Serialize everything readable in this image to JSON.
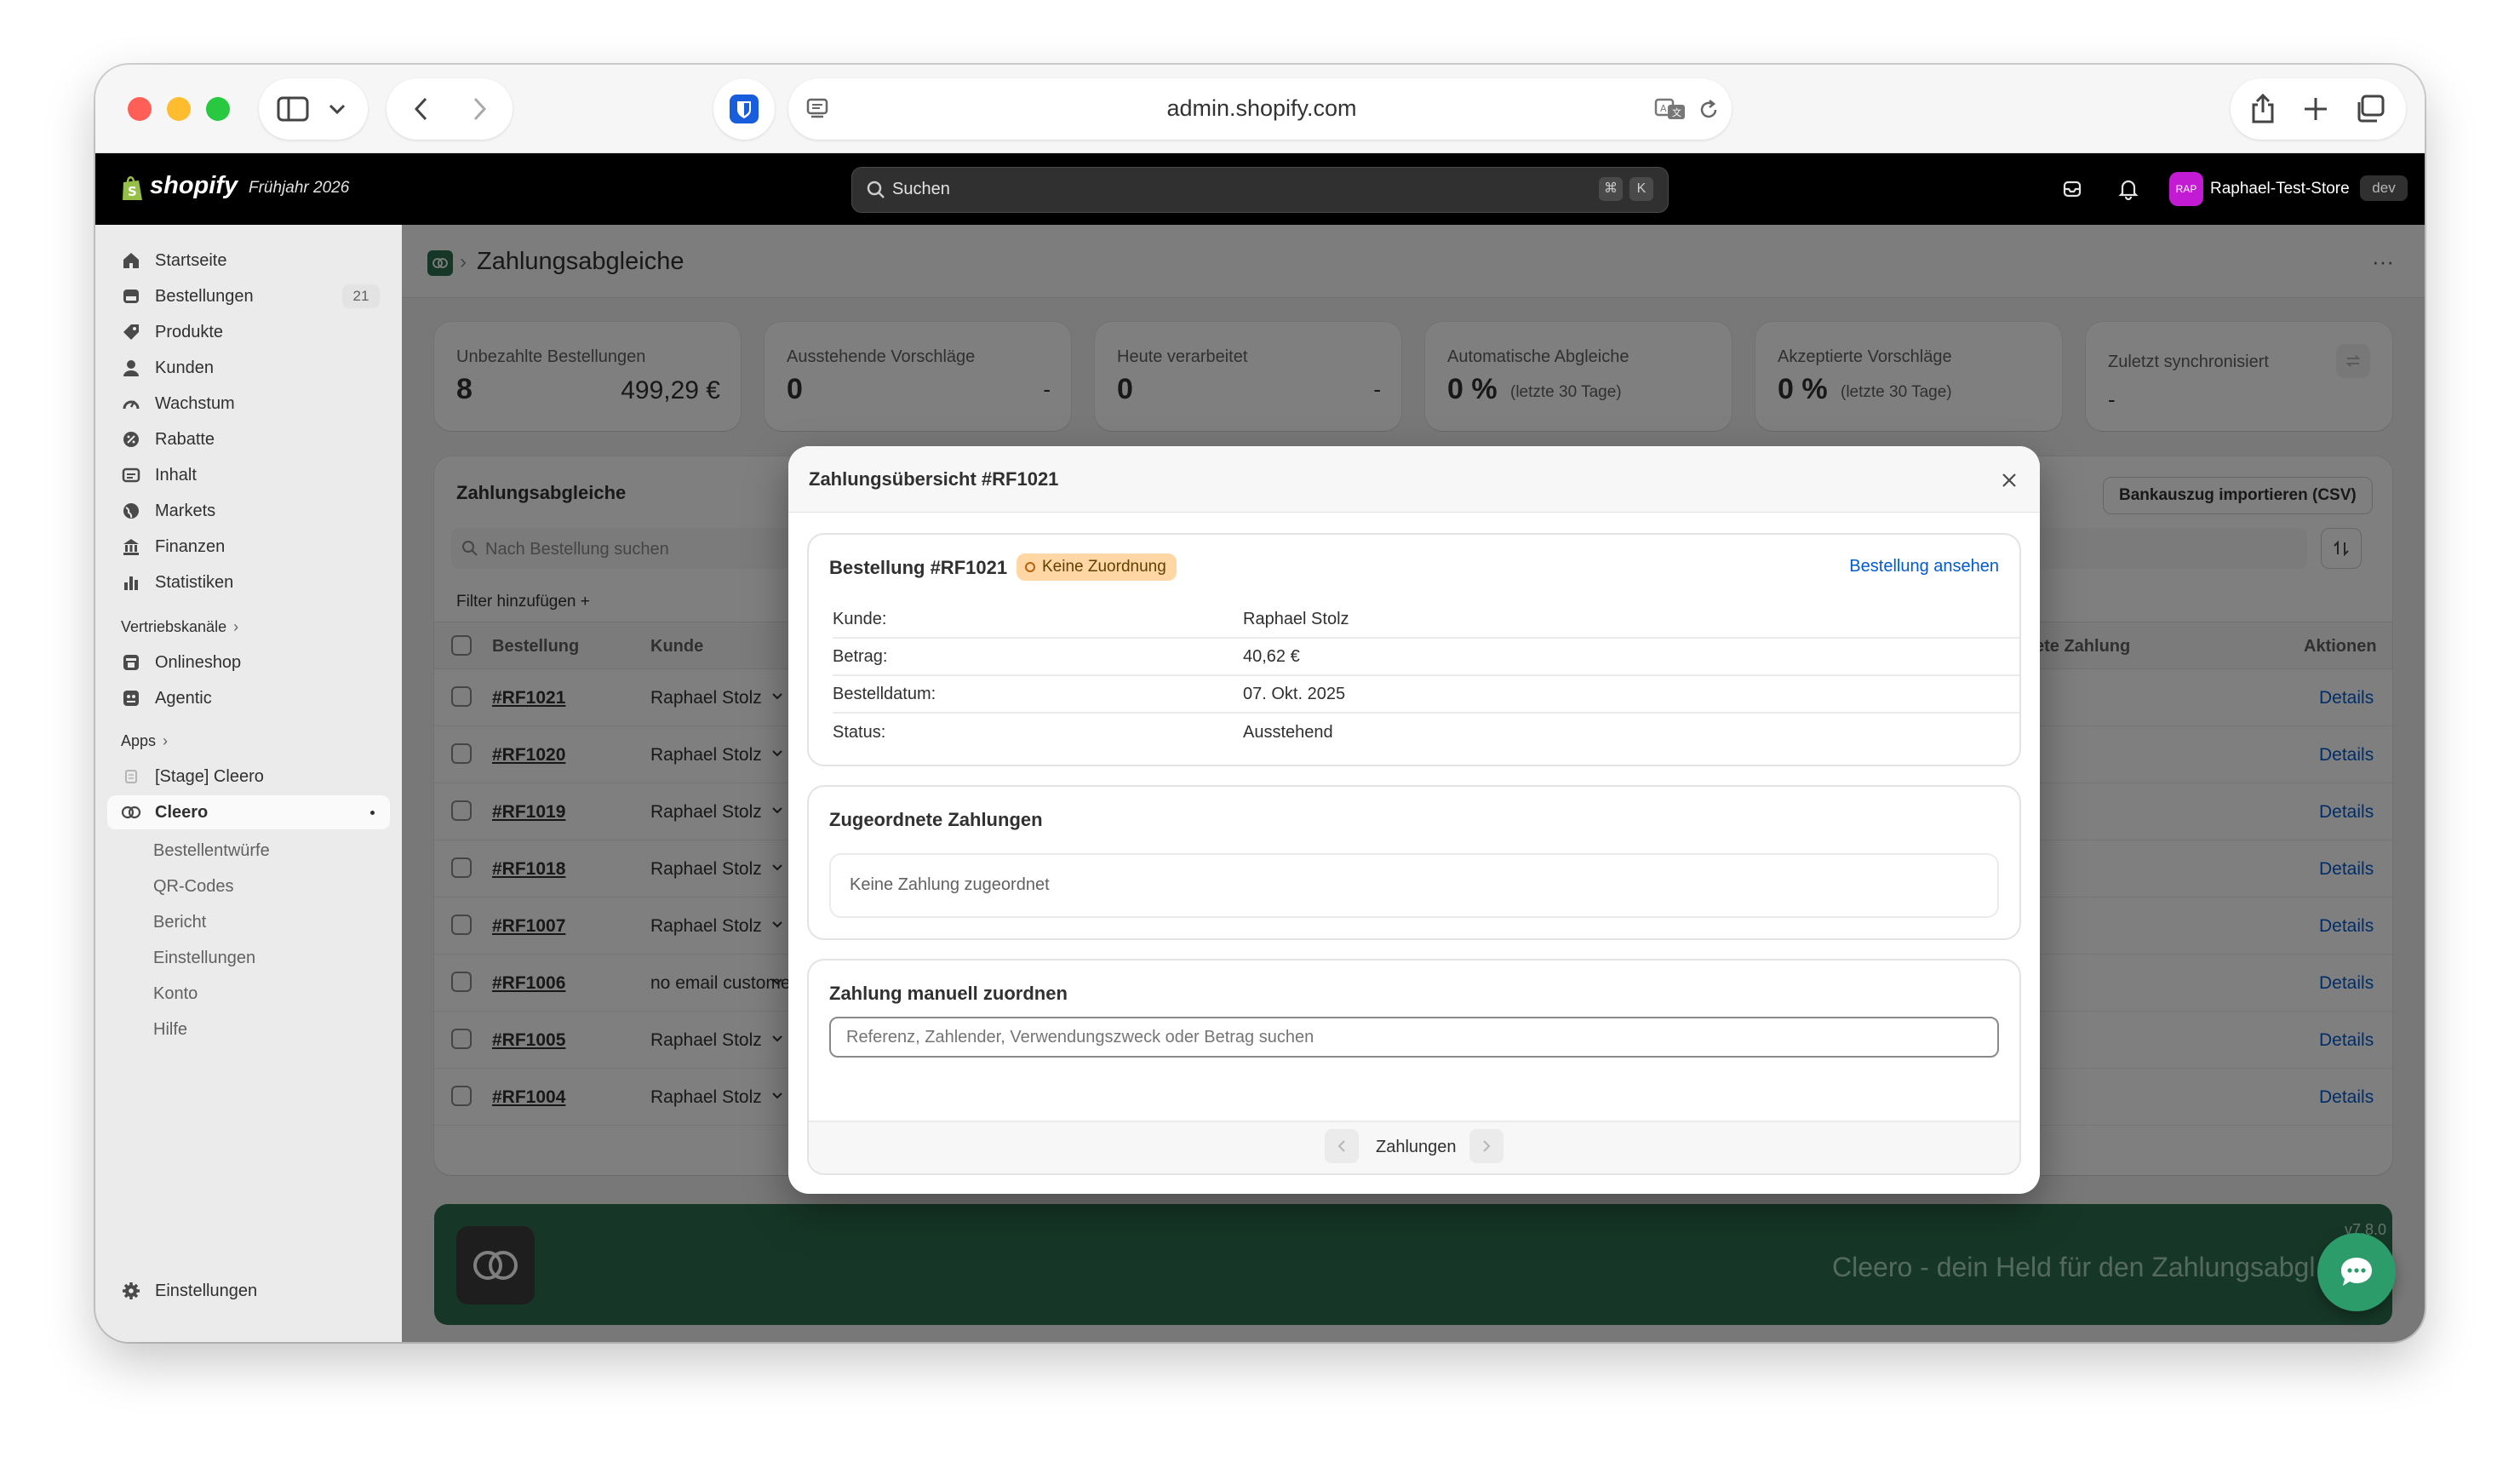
{
  "browser": {
    "url": "admin.shopify.com"
  },
  "topbar": {
    "brand": "shopify",
    "edition": "Frühjahr 2026",
    "search_placeholder": "Suchen",
    "shortcut_cmd": "⌘",
    "shortcut_key": "K",
    "store_initials": "RAP",
    "store_name": "Raphael-Test-Store",
    "env_badge": "dev"
  },
  "sidebar": {
    "items": [
      {
        "label": "Startseite",
        "icon": "home-icon"
      },
      {
        "label": "Bestellungen",
        "icon": "orders-icon",
        "badge": "21"
      },
      {
        "label": "Produkte",
        "icon": "tag-icon"
      },
      {
        "label": "Kunden",
        "icon": "person-icon"
      },
      {
        "label": "Wachstum",
        "icon": "gauge-icon"
      },
      {
        "label": "Rabatte",
        "icon": "discount-icon"
      },
      {
        "label": "Inhalt",
        "icon": "content-icon"
      },
      {
        "label": "Markets",
        "icon": "globe-icon"
      },
      {
        "label": "Finanzen",
        "icon": "bank-icon"
      },
      {
        "label": "Statistiken",
        "icon": "bar-chart-icon"
      }
    ],
    "channels_heading": "Vertriebskanäle",
    "channels": [
      {
        "label": "Onlineshop",
        "icon": "store-icon"
      },
      {
        "label": "Agentic",
        "icon": "agentic-icon"
      }
    ],
    "apps_heading": "Apps",
    "apps": [
      {
        "label": "[Stage] Cleero",
        "icon": "app-icon"
      },
      {
        "label": "Cleero",
        "icon": "cleero-icon"
      }
    ],
    "cleero_subitems": [
      "Bestellentwürfe",
      "QR-Codes",
      "Bericht",
      "Einstellungen",
      "Konto",
      "Hilfe"
    ],
    "settings_label": "Einstellungen"
  },
  "page": {
    "title": "Zahlungsabgleiche",
    "more_label": "···"
  },
  "kpis": [
    {
      "label": "Unbezahlte Bestellungen",
      "value": "8",
      "extra": "499,29 €",
      "note": ""
    },
    {
      "label": "Ausstehende Vorschläge",
      "value": "0",
      "extra": "-",
      "note": ""
    },
    {
      "label": "Heute verarbeitet",
      "value": "0",
      "extra": "-",
      "note": ""
    },
    {
      "label": "Automatische Abgleiche",
      "value": "0 %",
      "extra": "",
      "note": "(letzte 30 Tage)"
    },
    {
      "label": "Akzeptierte Vorschläge",
      "value": "0 %",
      "extra": "",
      "note": "(letzte 30 Tage)"
    },
    {
      "label": "Zuletzt synchronisiert",
      "value": "-",
      "extra": "",
      "note": ""
    }
  ],
  "table": {
    "title": "Zahlungsabgleiche",
    "import_button": "Bankauszug importieren (CSV)",
    "search_placeholder": "Nach Bestellung suchen",
    "filter_label": "Filter hinzufügen +",
    "columns": [
      "Bestellung",
      "Kunde",
      "ete Zahlung",
      "Aktionen"
    ],
    "rows": [
      {
        "order": "#RF1021",
        "customer": "Raphael Stolz",
        "action": "Details"
      },
      {
        "order": "#RF1020",
        "customer": "Raphael Stolz",
        "action": "Details"
      },
      {
        "order": "#RF1019",
        "customer": "Raphael Stolz",
        "action": "Details"
      },
      {
        "order": "#RF1018",
        "customer": "Raphael Stolz",
        "action": "Details"
      },
      {
        "order": "#RF1007",
        "customer": "Raphael Stolz",
        "action": "Details"
      },
      {
        "order": "#RF1006",
        "customer": "no email custome",
        "action": "Details"
      },
      {
        "order": "#RF1005",
        "customer": "Raphael Stolz",
        "action": "Details"
      },
      {
        "order": "#RF1004",
        "customer": "Raphael Stolz",
        "action": "Details"
      }
    ]
  },
  "banner": {
    "text": "Cleero - dein Held für den Zahlungsabgl",
    "version": "v7.8.0"
  },
  "modal": {
    "title": "Zahlungsübersicht #RF1021",
    "order_heading": "Bestellung #RF1021",
    "status_badge": "Keine Zuordnung",
    "view_order_link": "Bestellung ansehen",
    "details": [
      {
        "label": "Kunde:",
        "value": "Raphael Stolz"
      },
      {
        "label": "Betrag:",
        "value": "40,62 €"
      },
      {
        "label": "Bestelldatum:",
        "value": "07. Okt. 2025"
      },
      {
        "label": "Status:",
        "value": "Ausstehend"
      }
    ],
    "assigned_heading": "Zugeordnete Zahlungen",
    "assigned_empty": "Keine Zahlung zugeordnet",
    "manual_heading": "Zahlung manuell zuordnen",
    "manual_placeholder": "Referenz, Zahlender, Verwendungszweck oder Betrag suchen",
    "pagination_label": "Zahlungen"
  },
  "colors": {
    "brand_green": "#2c6e4f",
    "link_blue": "#005bd3",
    "badge_bg": "#ffd6a4",
    "avatar_pink": "#c21bd3"
  }
}
